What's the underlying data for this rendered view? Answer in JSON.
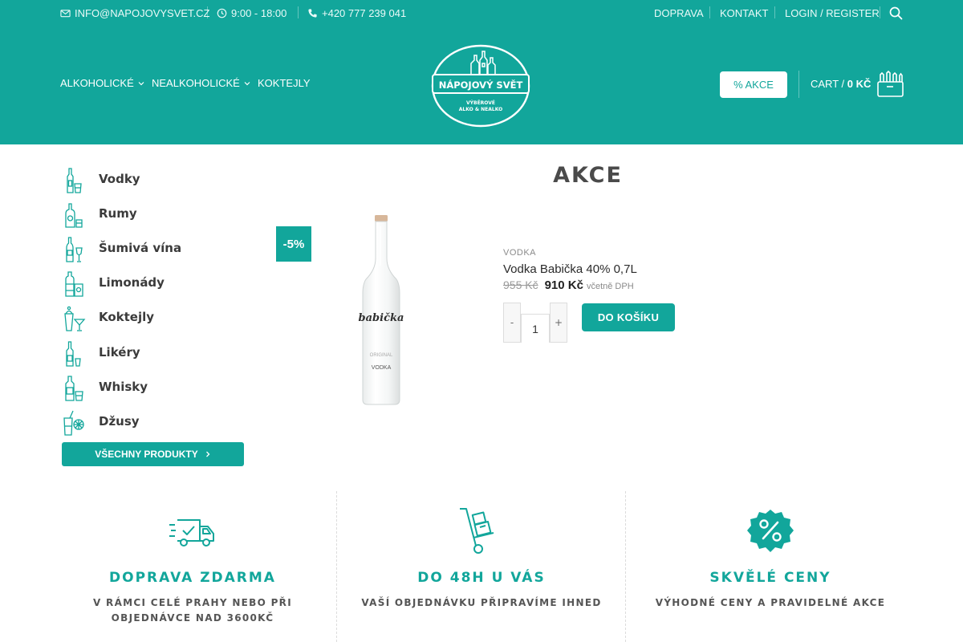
{
  "topbar": {
    "email": "INFO@NAPOJOVYSVET.CZ",
    "hours": "9:00 - 18:00",
    "phone": "+420 777 239 041",
    "links": [
      "DOPRAVA",
      "KONTAKT",
      "LOGIN / REGISTER"
    ]
  },
  "nav": {
    "items": [
      "ALKOHOLICKÉ",
      "NEALKOHOLICKÉ",
      "KOKTEJLY"
    ]
  },
  "logo": {
    "line1": "NÁPOJOVÝ SVĚT",
    "line2": "VÝBĚROVÉ",
    "line3": "ALKO & NEALKO"
  },
  "header": {
    "akce_label": "% AKCE",
    "cart_label": "CART /",
    "cart_total": "0 KČ"
  },
  "sidebar": {
    "categories": [
      "Vodky",
      "Rumy",
      "Šumivá vína",
      "Limonády",
      "Koktejly",
      "Likéry",
      "Whisky",
      "Džusy"
    ],
    "all_products": "VŠECHNY PRODUKTY"
  },
  "main": {
    "title": "AKCE",
    "product": {
      "badge": "-5%",
      "category": "VODKA",
      "name": "Vodka Babička 40% 0,7L",
      "price_old": "955 Kč",
      "price_new": "910 Kč",
      "tax_note": "včetně DPH",
      "qty": "1",
      "minus": "-",
      "plus": "+",
      "add_to_cart": "DO KOŠÍKU",
      "bottle_brand": "babička",
      "bottle_type": "VODKA",
      "bottle_sub": "ORIGINAL"
    }
  },
  "features": [
    {
      "title": "DOPRAVA ZDARMA",
      "text": "V RÁMCI CELÉ PRAHY NEBO PŘI OBJEDNÁVCE NAD 3600KČ",
      "icon": "truck-icon"
    },
    {
      "title": "DO 48H U VÁS",
      "text": "VAŠÍ OBJEDNÁVKU PŘIPRAVÍME IHNED",
      "icon": "hand-truck-icon"
    },
    {
      "title": "SKVĚLÉ CENY",
      "text": "VÝHODNÉ CENY A PRAVIDELNÉ AKCE",
      "icon": "percent-badge-icon"
    }
  ],
  "colors": {
    "brand": "#12a69b",
    "text": "#3b3b3b"
  }
}
